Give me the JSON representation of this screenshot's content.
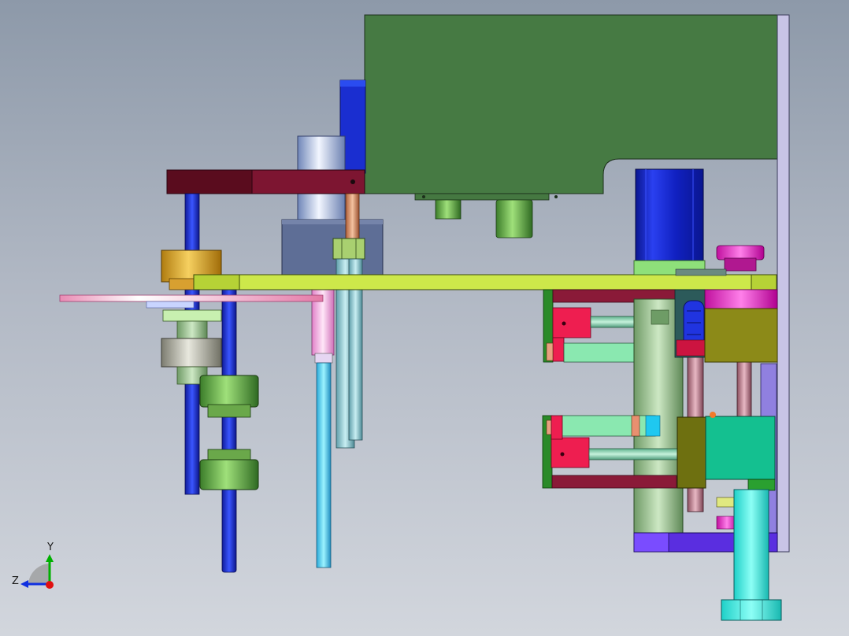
{
  "viewport": {
    "background_top": "#8d99a9",
    "background_bottom": "#d2d6dd"
  },
  "triad": {
    "y_label": "Y",
    "z_label": "Z",
    "y_color": "#00b000",
    "z_color": "#1030e0",
    "origin_color": "#e01010"
  },
  "colors": {
    "green_frame": "#467a43",
    "lime_plate": "#cde84a",
    "maroon_arm": "#7d1531",
    "blue_motor": "#1428c8",
    "cyan_column": "#38e8e0",
    "purple_base": "#5a2ee0",
    "side_plate": "#c8c4e6"
  }
}
